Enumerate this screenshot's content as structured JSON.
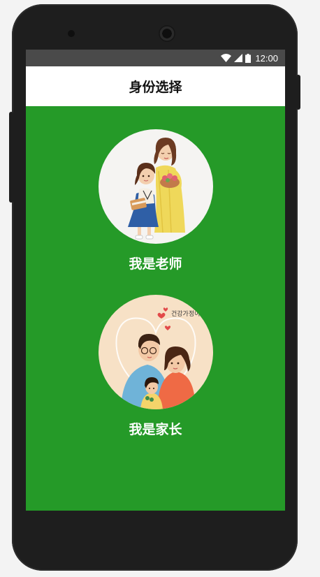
{
  "status_bar": {
    "time": "12:00",
    "icons": [
      "wifi-icon",
      "signal-icon",
      "battery-icon"
    ]
  },
  "header": {
    "title": "身份选择"
  },
  "roles": [
    {
      "label": "我是老师",
      "illustration": "teacher-student-illustration"
    },
    {
      "label": "我是家长",
      "illustration": "parent-child-illustration",
      "illustration_text": "건강가정이 좋"
    }
  ],
  "colors": {
    "background": "#259a28",
    "header_bg": "#ffffff",
    "status_bar_bg": "#4a4a4a",
    "label_text": "#ffffff"
  }
}
